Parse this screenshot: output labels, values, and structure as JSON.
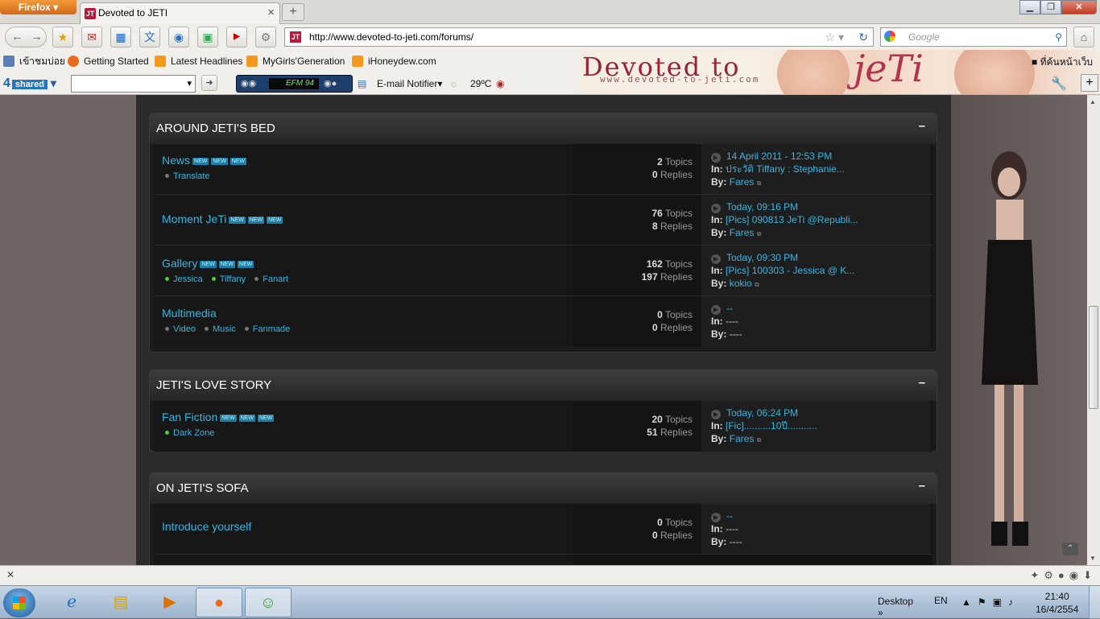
{
  "browser": {
    "app_button": "Firefox",
    "tab_title": "Devoted to JETI",
    "tab_favicon": "jeti-favicon",
    "url": "http://www.devoted-to-jeti.com/forums/",
    "search_placeholder": "Google",
    "window_controls": [
      "minimize",
      "maximize",
      "close"
    ]
  },
  "bookmarks": [
    {
      "label": "เข้าชมบ่อย",
      "icon": "bookmark-folder-icon"
    },
    {
      "label": "Getting Started",
      "icon": "firefox-icon"
    },
    {
      "label": "Latest Headlines",
      "icon": "rss-icon"
    },
    {
      "label": "MyGirls'Generation",
      "icon": "rss-icon"
    },
    {
      "label": "iHoneydew.com",
      "icon": "rss-icon"
    }
  ],
  "toolbar3": {
    "fourshared_label": "4",
    "fourshared_suffix": "shared",
    "radio_display": "EFM 94",
    "email_notifier": "E-mail Notifier",
    "weather": "29ºC"
  },
  "banner": {
    "title": "Devoted to",
    "url_text": "www.devoted-to-jeti.com",
    "logo": "jeTi",
    "bookmark_label": "ที่ค้นหน้าเว็บ"
  },
  "forum": {
    "categories": [
      {
        "title": "AROUND JETI'S BED",
        "collapse": "–",
        "forums": [
          {
            "name": "News",
            "badges": [
              "NEW",
              "NEW",
              "NEW"
            ],
            "subs": [
              {
                "label": "Translate",
                "dot": "grey"
              }
            ],
            "topics": "2",
            "replies": "0",
            "topics_label": "Topics",
            "replies_label": "Replies",
            "last_date": "14 April 2011 - 12:53 PM",
            "last_in": "ประวัติ Tiffany : Stephanie...",
            "last_by": "Fares",
            "in_label": "In:",
            "by_label": "By:"
          },
          {
            "name": "Moment JeTi",
            "badges": [
              "NEW",
              "NEW",
              "NEW"
            ],
            "subs": [],
            "topics": "76",
            "replies": "8",
            "topics_label": "Topics",
            "replies_label": "Replies",
            "last_date": "Today, 09:16 PM",
            "last_in": "[Pics] 090813 JeTi @Republi...",
            "last_by": "Fares",
            "in_label": "In:",
            "by_label": "By:"
          },
          {
            "name": "Gallery",
            "badges": [
              "NEW",
              "NEW",
              "NEW"
            ],
            "subs": [
              {
                "label": "Jessica",
                "dot": "green"
              },
              {
                "label": "Tiffany",
                "dot": "green"
              },
              {
                "label": "Fanart",
                "dot": "grey"
              }
            ],
            "topics": "162",
            "replies": "197",
            "topics_label": "Topics",
            "replies_label": "Replies",
            "last_date": "Today, 09:30 PM",
            "last_in": "[Pics] 100303 - Jessica @ K...",
            "last_by": "kokio",
            "in_label": "In:",
            "by_label": "By:"
          },
          {
            "name": "Multimedia",
            "badges": [],
            "subs": [
              {
                "label": "Video",
                "dot": "grey"
              },
              {
                "label": "Music",
                "dot": "grey"
              },
              {
                "label": "Fanmade",
                "dot": "grey"
              }
            ],
            "topics": "0",
            "replies": "0",
            "topics_label": "Topics",
            "replies_label": "Replies",
            "last_date": "--",
            "last_in": "----",
            "last_by": "----",
            "in_label": "In:",
            "by_label": "By:"
          }
        ]
      },
      {
        "title": "JETI'S LOVE STORY",
        "collapse": "–",
        "forums": [
          {
            "name": "Fan Fiction",
            "badges": [
              "NEW",
              "NEW",
              "NEW"
            ],
            "subs": [
              {
                "label": "Dark Zone",
                "dot": "green"
              }
            ],
            "topics": "20",
            "replies": "51",
            "topics_label": "Topics",
            "replies_label": "Replies",
            "last_date": "Today, 06:24 PM",
            "last_in": "[Fic]..........10ปี...........",
            "last_by": "Fares",
            "in_label": "In:",
            "by_label": "By:"
          }
        ]
      },
      {
        "title": "ON JETI'S SOFA",
        "collapse": "–",
        "forums": [
          {
            "name": "Introduce yourself",
            "badges": [],
            "subs": [],
            "topics": "0",
            "replies": "0",
            "topics_label": "Topics",
            "replies_label": "Replies",
            "last_date": "--",
            "last_in": "----",
            "last_by": "----",
            "in_label": "In:",
            "by_label": "By:"
          }
        ]
      }
    ]
  },
  "taskbar": {
    "desktop_label": "Desktop",
    "language": "EN",
    "time": "21:40",
    "date": "16/4/2554",
    "apps": [
      "internet-explorer-icon",
      "explorer-icon",
      "media-player-icon",
      "firefox-icon",
      "messenger-icon"
    ]
  },
  "colors": {
    "link": "#36b6e3",
    "banner_text": "#9a2233"
  }
}
